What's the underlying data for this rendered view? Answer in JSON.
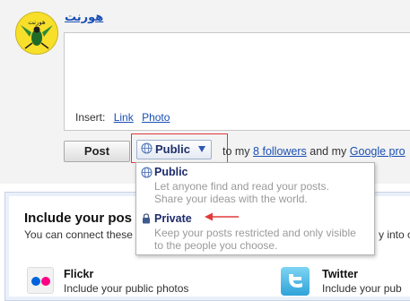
{
  "user": {
    "name": "هورنت",
    "avatar_label": "هورنت"
  },
  "insert": {
    "label": "Insert:",
    "links": [
      "Link",
      "Photo"
    ]
  },
  "actions": {
    "post_label": "Post",
    "privacy_selected": "Public"
  },
  "share_line": {
    "prefix": "to my",
    "followers_link": "8 followers",
    "middle": "and my",
    "profile_link": "Google pro"
  },
  "privacy_menu": {
    "options": [
      {
        "title": "Public",
        "description_line1": "Let anyone find and read your posts.",
        "description_line2": "Share your ideas with the world.",
        "icon": "globe-icon"
      },
      {
        "title": "Private",
        "description_line1": "Keep your posts restricted and only visible",
        "description_line2": "to the people you choose.",
        "icon": "lock-icon"
      }
    ]
  },
  "include_section": {
    "title": "Include your pos",
    "description": "You can connect these",
    "description_tail": "y into o",
    "services": [
      {
        "name": "Flickr",
        "description": "Include your public photos",
        "icon": "flickr-icon"
      },
      {
        "name": "Twitter",
        "description": "Include your pub",
        "icon": "twitter-icon"
      }
    ]
  },
  "colors": {
    "link": "#1a4fb4",
    "highlight_box": "#e03a3a",
    "menu_title": "#1c2b6b",
    "menu_desc": "#9a9a9a"
  }
}
